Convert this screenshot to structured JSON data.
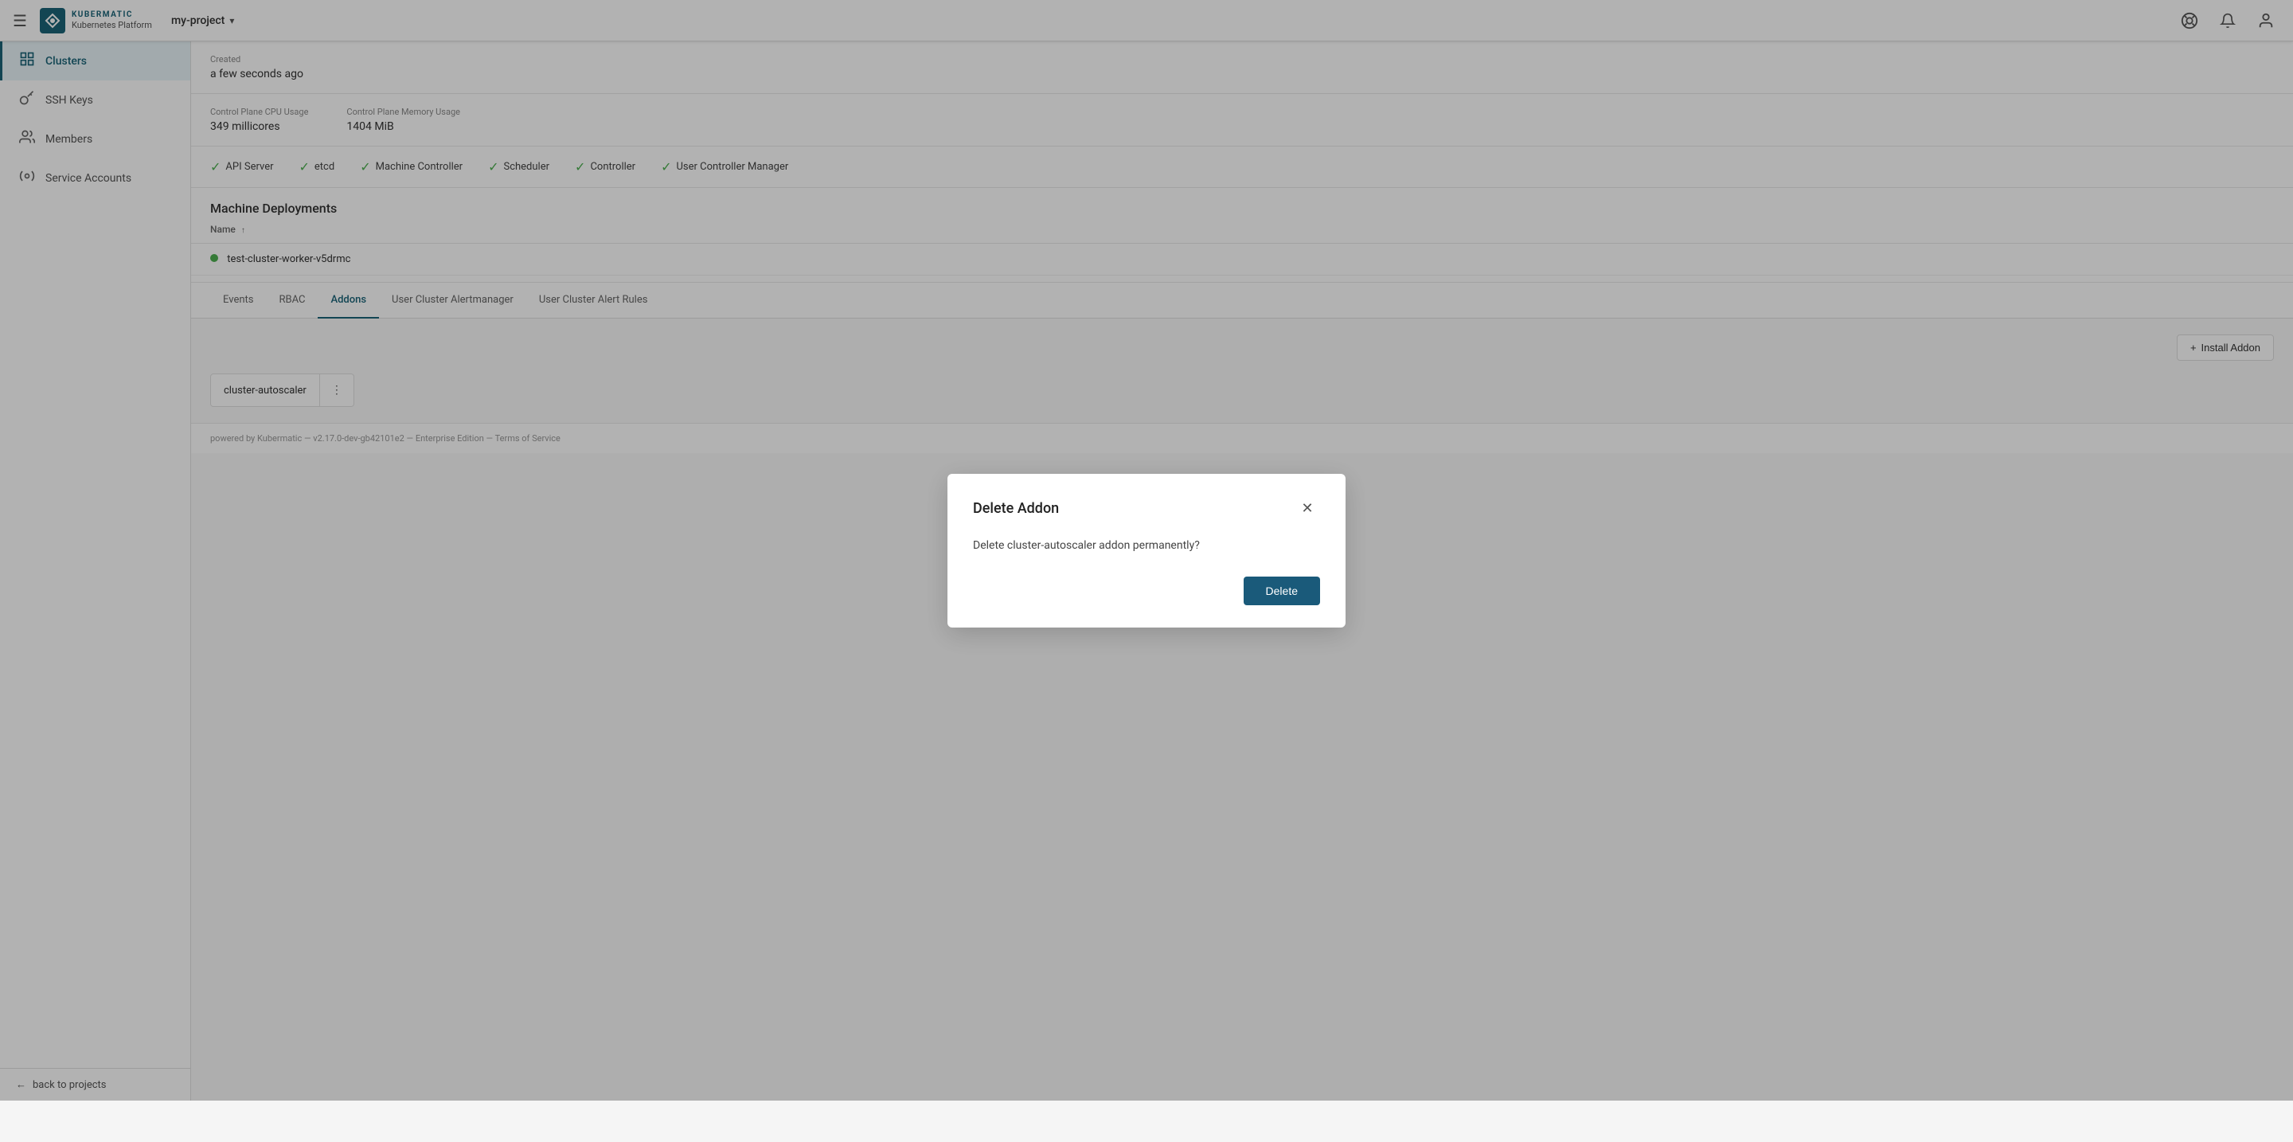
{
  "header": {
    "hamburger_label": "☰",
    "logo_kubermatic": "KUBERMATIC",
    "logo_platform": "Kubernetes Platform",
    "project_name": "my-project",
    "chevron": "▾",
    "icons": {
      "support": "⊙",
      "bell": "🔔",
      "user": "👤"
    }
  },
  "sidebar": {
    "items": [
      {
        "id": "clusters",
        "label": "Clusters",
        "icon": "⊞",
        "active": true
      },
      {
        "id": "ssh-keys",
        "label": "SSH Keys",
        "icon": "🔑",
        "active": false
      },
      {
        "id": "members",
        "label": "Members",
        "icon": "👥",
        "active": false
      },
      {
        "id": "service-accounts",
        "label": "Service Accounts",
        "icon": "⚙",
        "active": false
      }
    ],
    "back_label": "back to projects",
    "back_icon": "←"
  },
  "cluster_info": {
    "created_label": "Created",
    "created_value": "a few seconds ago",
    "cpu_label": "Control Plane CPU Usage",
    "cpu_value": "349 millicores",
    "memory_label": "Control Plane Memory Usage",
    "memory_value": "1404 MiB"
  },
  "health_items": [
    {
      "label": "API Server"
    },
    {
      "label": "etcd"
    },
    {
      "label": "Machine Controller"
    },
    {
      "label": "Scheduler"
    },
    {
      "label": "Controller"
    },
    {
      "label": "User Controller Manager"
    }
  ],
  "deployments": {
    "section_title": "Machine Deployments",
    "table": {
      "columns": [
        {
          "label": "Name",
          "sort": "↑"
        }
      ],
      "rows": [
        {
          "status": "green",
          "name": "test-cluster-worker-v5drmc"
        }
      ]
    }
  },
  "tabs": [
    {
      "id": "events",
      "label": "Events",
      "active": false
    },
    {
      "id": "rbac",
      "label": "RBAC",
      "active": false
    },
    {
      "id": "addons",
      "label": "Addons",
      "active": true
    },
    {
      "id": "alertmanager",
      "label": "User Cluster Alertmanager",
      "active": false
    },
    {
      "id": "alert-rules",
      "label": "User Cluster Alert Rules",
      "active": false
    }
  ],
  "addons": {
    "install_btn_label": "Install Addon",
    "install_btn_icon": "+",
    "items": [
      {
        "name": "cluster-autoscaler"
      }
    ]
  },
  "modal": {
    "title": "Delete Addon",
    "close_icon": "✕",
    "body_text": "Delete cluster-autoscaler addon permanently?",
    "delete_btn_label": "Delete"
  },
  "footer": {
    "text": "powered by Kubermatic — v2.17.0-dev-gb42101e2 — Enterprise Edition — Terms of Service",
    "social_icons": [
      "🐦",
      "🖥",
      "📊"
    ]
  }
}
